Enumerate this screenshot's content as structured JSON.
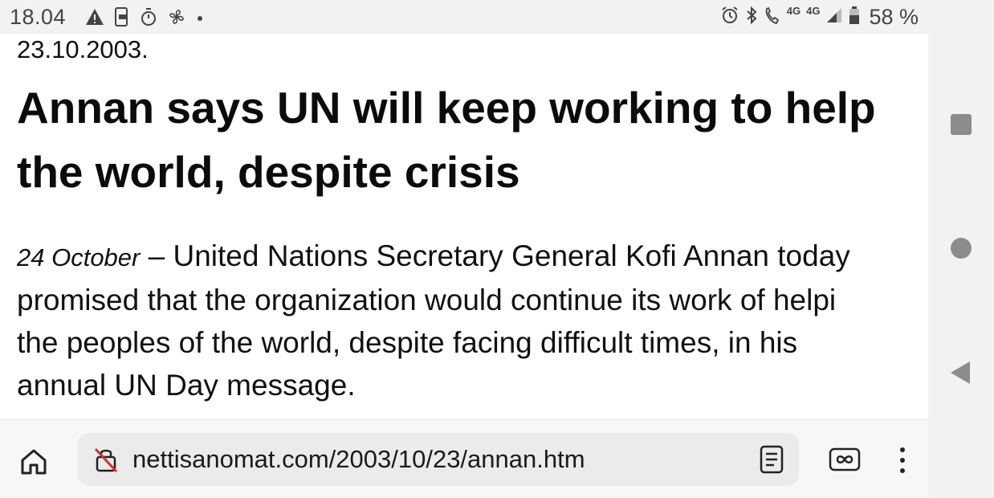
{
  "status_bar": {
    "time": "18.04",
    "left_icons": [
      "warning-icon",
      "screenshot-icon",
      "timer-icon",
      "fan-icon",
      "dot-icon"
    ],
    "right_icons": [
      "alarm-icon",
      "bluetooth-icon",
      "volte-icon",
      "signal-icon",
      "battery-icon"
    ],
    "network_small": "4G",
    "network_large": "4G",
    "battery_percent": "58 %"
  },
  "article": {
    "date": "23.10.2003.",
    "headline": "Annan says UN will keep working to help the world, despite crisis",
    "dateline": "24 October",
    "body_lines": [
      " – United Nations Secretary General Kofi Annan today",
      "promised that the organization would continue its work of helpi",
      "the peoples of the world, despite facing difficult times, in his",
      "annual UN Day message."
    ]
  },
  "browser": {
    "url": "nettisanomat.com/2003/10/23/annan.htm",
    "connection_status": "not-secure",
    "icons": [
      "home-icon",
      "insecure-lock-icon",
      "reader-mode-icon",
      "tabs-icon",
      "more-vert-icon"
    ]
  },
  "nav_bar": {
    "buttons": [
      "recents-button",
      "home-button",
      "back-button"
    ]
  },
  "colors": {
    "page_bg": "#ffffff",
    "chrome_bg": "#f2f2f2",
    "url_box_bg": "#ebebeb",
    "text": "#111111",
    "insecure_accent": "#d93025"
  }
}
